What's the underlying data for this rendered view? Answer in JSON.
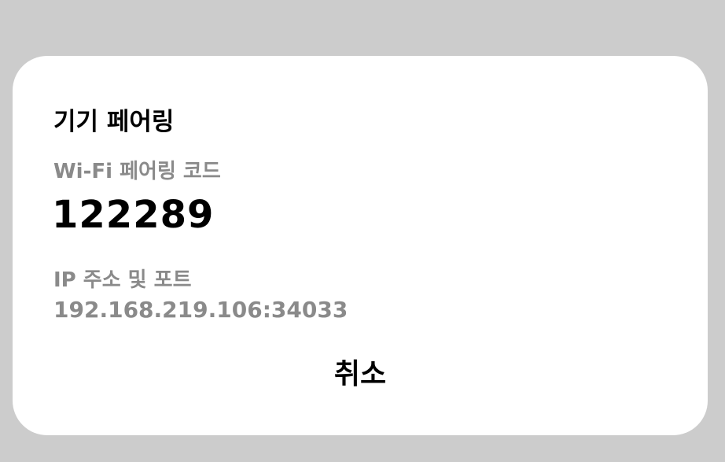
{
  "dialog": {
    "title": "기기 페어링",
    "wifi_label": "Wi-Fi 페어링 코드",
    "pairing_code": "122289",
    "ip_label": "IP 주소 및 포트",
    "ip_port": "192.168.219.106:34033",
    "cancel_label": "취소"
  },
  "colors": {
    "backdrop": "#cccccc",
    "dialog_background": "#ffffff",
    "primary_text": "#000000",
    "secondary_text": "#8a8a8a"
  }
}
